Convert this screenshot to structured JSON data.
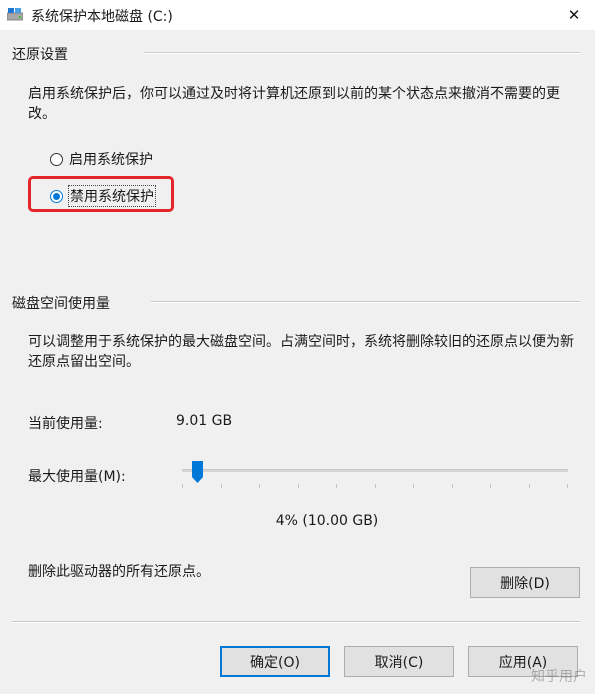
{
  "window": {
    "title": "系统保护本地磁盘 (C:)",
    "icon": "drive-icon",
    "close_glyph": "✕"
  },
  "restore_settings": {
    "label": "还原设置",
    "description": "启用系统保护后，你可以通过及时将计算机还原到以前的某个状态点来撤消不需要的更改。",
    "option_enable": "启用系统保护",
    "option_disable": "禁用系统保护",
    "selected": "disable",
    "highlight_color": "#e3262a"
  },
  "disk_usage": {
    "label": "磁盘空间使用量",
    "description": "可以调整用于系统保护的最大磁盘空间。占满空间时，系统将删除较旧的还原点以便为新还原点留出空间。",
    "current_label": "当前使用量:",
    "current_value": "9.01 GB",
    "max_label": "最大使用量(M):",
    "slider_percent": 4,
    "slider_readout": "4% (10.00 GB)"
  },
  "delete": {
    "text": "删除此驱动器的所有还原点。",
    "button_label": "删除(D)"
  },
  "buttons": {
    "ok": "确定(O)",
    "cancel": "取消(C)",
    "apply": "应用(A)"
  },
  "watermark": "知乎用户",
  "colors": {
    "accent": "#0078d7",
    "background": "#f0f0f0"
  }
}
